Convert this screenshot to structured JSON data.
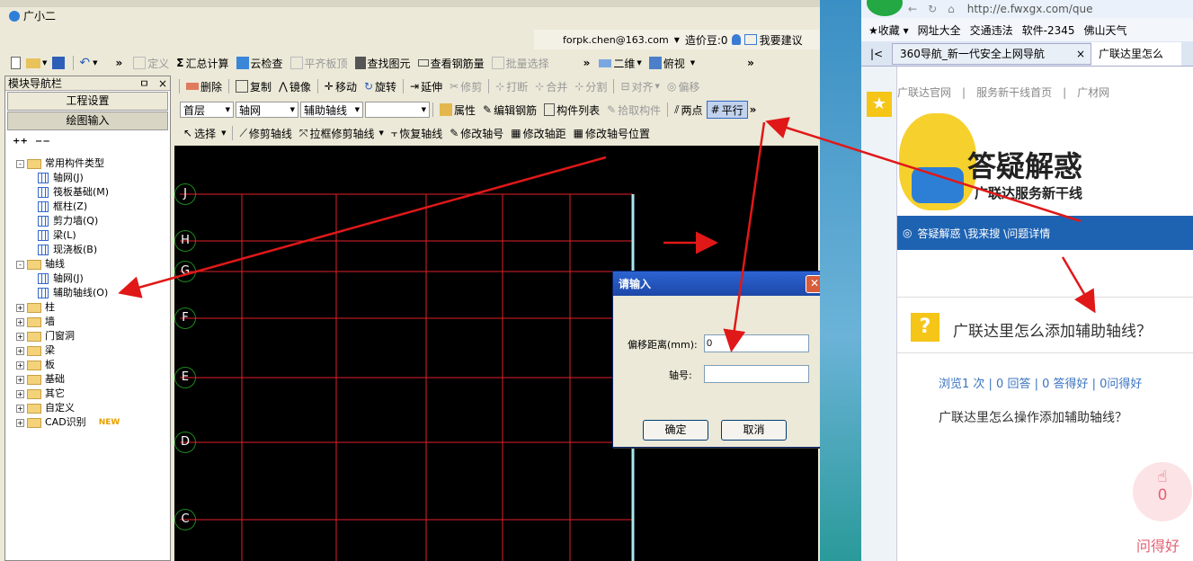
{
  "app": {
    "title_partial": "广小二",
    "user_email": "forpk.chen@163.com",
    "credit": "造价豆:0",
    "suggest": "我要建议"
  },
  "toolbar1": {
    "define": "定义",
    "sum": "汇总计算",
    "cloud": "云检查",
    "flat": "平齐板顶",
    "find": "查找图元",
    "view_rebar": "查看钢筋量",
    "batch": "批量选择",
    "mode_2d": "二维",
    "view": "俯视"
  },
  "toolbar2": {
    "delete": "删除",
    "copy": "复制",
    "mirror": "镜像",
    "move": "移动",
    "rotate": "旋转",
    "extend": "延伸",
    "trim": "修剪",
    "break": "打断",
    "merge": "合并",
    "split": "分割",
    "align": "对齐",
    "offset": "偏移"
  },
  "toolbar3": {
    "floor": "首层",
    "type": "轴网",
    "subtype": "辅助轴线",
    "blank": "",
    "props": "属性",
    "edit_rebar": "编辑钢筋",
    "list": "构件列表",
    "pick": "拾取构件",
    "two_point": "两点",
    "parallel": "平行"
  },
  "toolbar4": {
    "select": "选择",
    "trim_axis": "修剪轴线",
    "box_trim": "拉框修剪轴线",
    "restore": "恢复轴线",
    "mod_num": "修改轴号",
    "mod_dist": "修改轴距",
    "mod_pos": "修改轴号位置"
  },
  "nav": {
    "title": "模块导航栏",
    "pin": "中",
    "close": "×",
    "btn_project": "工程设置",
    "btn_draw": "绘图输入",
    "tree": [
      {
        "label": "常用构件类型",
        "level": 0,
        "kind": "folder",
        "exp": "-"
      },
      {
        "label": "轴网(J)",
        "level": 1,
        "kind": "item"
      },
      {
        "label": "筏板基础(M)",
        "level": 1,
        "kind": "item"
      },
      {
        "label": "框柱(Z)",
        "level": 1,
        "kind": "item"
      },
      {
        "label": "剪力墙(Q)",
        "level": 1,
        "kind": "item"
      },
      {
        "label": "梁(L)",
        "level": 1,
        "kind": "item"
      },
      {
        "label": "现浇板(B)",
        "level": 1,
        "kind": "item"
      },
      {
        "label": "轴线",
        "level": 0,
        "kind": "folder",
        "exp": "-"
      },
      {
        "label": "轴网(J)",
        "level": 1,
        "kind": "item"
      },
      {
        "label": "辅助轴线(O)",
        "level": 1,
        "kind": "item"
      },
      {
        "label": "柱",
        "level": 0,
        "kind": "folder",
        "exp": "+"
      },
      {
        "label": "墙",
        "level": 0,
        "kind": "folder",
        "exp": "+"
      },
      {
        "label": "门窗洞",
        "level": 0,
        "kind": "folder",
        "exp": "+"
      },
      {
        "label": "梁",
        "level": 0,
        "kind": "folder",
        "exp": "+"
      },
      {
        "label": "板",
        "level": 0,
        "kind": "folder",
        "exp": "+"
      },
      {
        "label": "基础",
        "level": 0,
        "kind": "folder",
        "exp": "+"
      },
      {
        "label": "其它",
        "level": 0,
        "kind": "folder",
        "exp": "+"
      },
      {
        "label": "自定义",
        "level": 0,
        "kind": "folder",
        "exp": "+"
      },
      {
        "label": "CAD识别",
        "level": 0,
        "kind": "folder",
        "exp": "+",
        "badge": "NEW"
      }
    ]
  },
  "canvas": {
    "axes": [
      "J",
      "H",
      "G",
      "F",
      "E",
      "D",
      "C"
    ]
  },
  "dialog": {
    "title": "请输入",
    "offset_label": "偏移距离(mm):",
    "offset_value": "0",
    "axis_label": "轴号:",
    "axis_value": "",
    "ok": "确定",
    "cancel": "取消"
  },
  "browser": {
    "url": "http://e.fwxgx.com/que",
    "fav": "收藏",
    "bm1": "网址大全",
    "bm2": "交通违法",
    "bm3": "软件-2345",
    "bm4": "佛山天气",
    "tab1": "360导航_新一代安全上网导航",
    "tab2": "广联达里怎么",
    "links": [
      "广联达官网",
      "服务新干线首页",
      "广材网"
    ],
    "banner_title": "答疑解惑",
    "banner_sub": "广联达服务新干线",
    "breadcrumb": "答疑解惑 \\我来搜 \\问题详情",
    "question": "广联达里怎么添加辅助轴线？",
    "stats": "浏览1 次 | 0 回答 | 0 答得好 | 0问得好",
    "question_body": "广联达里怎么操作添加辅助轴线？",
    "like_count": "0",
    "ask_good": "问得好"
  }
}
